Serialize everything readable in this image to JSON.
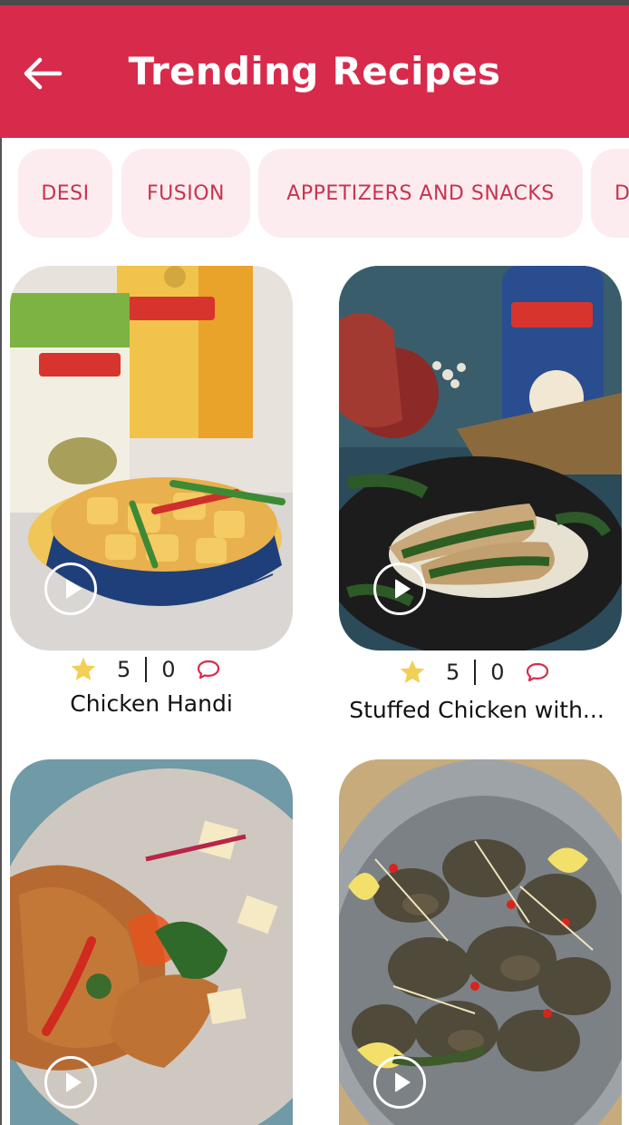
{
  "header": {
    "title": "Trending Recipes",
    "back_icon": "arrow-left-icon",
    "color": "#d82b4c"
  },
  "categories": [
    "DESI",
    "FUSION",
    "APPETIZERS AND SNACKS",
    "D"
  ],
  "recipes": [
    {
      "name": "Chicken Handi",
      "rating": "5",
      "comments": "0"
    },
    {
      "name": "Stuffed Chicken with...",
      "rating": "5",
      "comments": "0"
    },
    {
      "name": "",
      "rating": "",
      "comments": ""
    },
    {
      "name": "",
      "rating": "",
      "comments": ""
    }
  ],
  "icons": {
    "star": "star-icon",
    "comment": "comment-icon",
    "play": "play-icon"
  },
  "colors": {
    "chip_bg": "#fcecef",
    "chip_text": "#c8334f",
    "star": "#f2cf55",
    "comment": "#d82b4c"
  }
}
